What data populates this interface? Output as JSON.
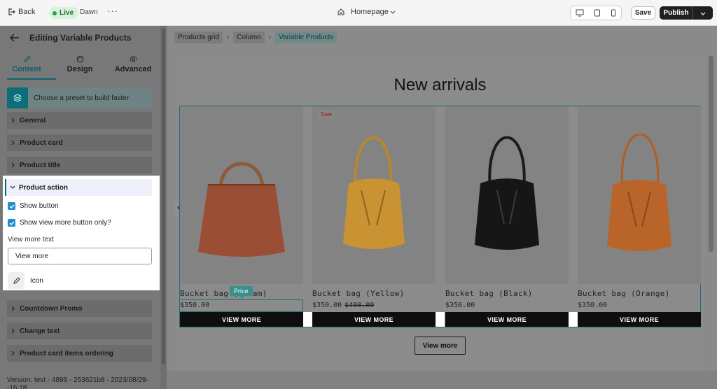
{
  "topbar": {
    "back_label": "Back",
    "live_label": "Live",
    "theme_name": "Dawn",
    "more_label": "···",
    "page_name": "Homepage",
    "save_label": "Save",
    "publish_label": "Publish"
  },
  "panel": {
    "title": "Editing Variable Products",
    "tabs": [
      {
        "label": "Content",
        "icon": "pencil-icon",
        "active": true
      },
      {
        "label": "Design",
        "icon": "palette-icon",
        "active": false
      },
      {
        "label": "Advanced",
        "icon": "gear-icon",
        "active": false
      }
    ],
    "preset_label": "Choose a preset to build faster",
    "sections_top": [
      "General",
      "Product card",
      "Product title"
    ],
    "product_action": {
      "title": "Product action",
      "show_button_label": "Show button",
      "show_button_checked": true,
      "view_more_only_label": "Show view more button only?",
      "view_more_only_checked": true,
      "view_more_text_label": "View more text",
      "view_more_text_value": "View more",
      "icon_label": "Icon"
    },
    "sections_bottom": [
      "Countdown Promo",
      "Change text",
      "Product card items ordering"
    ],
    "version": "Version: test - 4899 - 253621b8 - 2023/08/29--16:18"
  },
  "breadcrumb": [
    "Products grid",
    "Column",
    "Variable Products"
  ],
  "canvas": {
    "section_title": "New arrivals",
    "price_tooltip": "Price",
    "view_more_button": "View more",
    "products": [
      {
        "name": "Bucket bag (Cream)",
        "price": "$350.00",
        "old_price": "",
        "sale": "",
        "button": "VIEW MORE",
        "color": "#a85a3c"
      },
      {
        "name": "Bucket bag (Yellow)",
        "price": "$350.00",
        "old_price": "$400.00",
        "sale": "Sale",
        "button": "VIEW MORE",
        "color": "#d9a43a"
      },
      {
        "name": "Bucket bag (Black)",
        "price": "$350.00",
        "old_price": "",
        "sale": "",
        "button": "VIEW MORE",
        "color": "#1a1a1a"
      },
      {
        "name": "Bucket bag (Orange)",
        "price": "$350.00",
        "old_price": "",
        "sale": "",
        "button": "VIEW MORE",
        "color": "#d0742f"
      }
    ]
  },
  "colors": {
    "accent": "#0e6470",
    "checkbox": "#1d8fcb",
    "publish_bg": "#1f1f1f"
  }
}
